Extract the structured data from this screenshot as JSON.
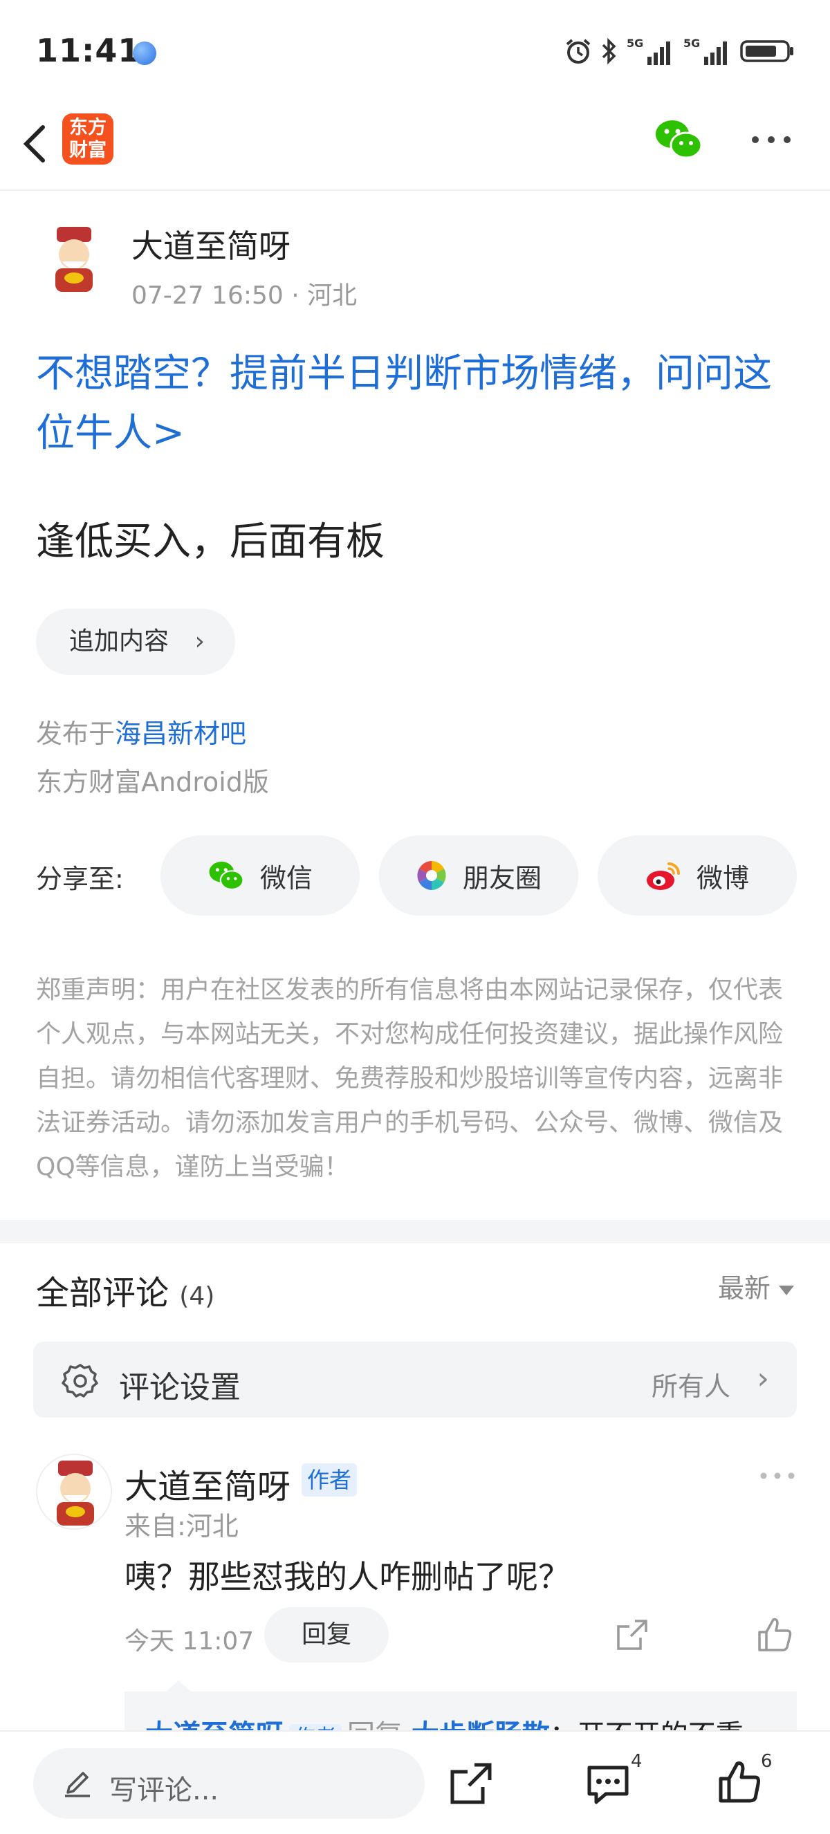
{
  "status_bar": {
    "time": "11:41",
    "network1": "5G",
    "network2": "5G"
  },
  "nav": {
    "logo_text_line1": "东方",
    "logo_text_line2": "财富"
  },
  "post": {
    "author": "大道至简呀",
    "time": "07-27 16:50",
    "location": "河北",
    "promo_text": "不想踏空？提前半日判断市场情绪，问问这位牛人>",
    "body": "逢低买入，后面有板",
    "append_label": "追加内容",
    "published_prefix": "发布于",
    "bar_name": "海昌新材吧",
    "client": "东方财富Android版"
  },
  "share": {
    "label": "分享至:",
    "wechat": "微信",
    "moments": "朋友圈",
    "weibo": "微博"
  },
  "disclaimer": "郑重声明：用户在社区发表的所有信息将由本网站记录保存，仅代表个人观点，与本网站无关，不对您构成任何投资建议，据此操作风险自担。请勿相信代客理财、免费荐股和炒股培训等宣传内容，远离非法证券活动。请勿添加发言用户的手机号码、公众号、微博、微信及QQ等信息，谨防上当受骗！",
  "comments": {
    "title": "全部评论",
    "count": "(4)",
    "sort": "最新",
    "settings_label": "评论设置",
    "settings_value": "所有人",
    "items": [
      {
        "name": "大道至简呀",
        "tag": "作者",
        "from": "来自:河北",
        "text": "咦？那些怼我的人咋删帖了呢？",
        "time": "今天 11:07",
        "reply_label": "回复",
        "reply": {
          "name": "大道至简呀",
          "tag": "作者",
          "word": "回复",
          "target": "大步断肠散",
          "text": "：开不开的不重"
        }
      }
    ]
  },
  "bottom_bar": {
    "placeholder": "写评论...",
    "comment_count": "4",
    "like_count": "6"
  },
  "colors": {
    "link_blue": "#1f6ed6",
    "logo_orange": "#f4511e",
    "wechat_green": "#2dc100"
  }
}
